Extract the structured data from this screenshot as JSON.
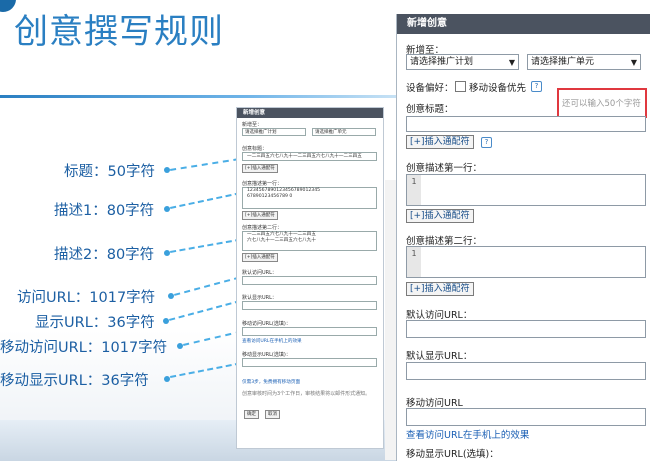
{
  "slide": {
    "title": "创意撰写规则"
  },
  "annotations": [
    {
      "label": "标题：50字符"
    },
    {
      "label": "描述1：80字符"
    },
    {
      "label": "描述2：80字符"
    },
    {
      "label": "访问URL：1017字符"
    },
    {
      "label": "显示URL：36字符"
    },
    {
      "label": "移动访问URL：1017字符"
    },
    {
      "label": "移动显示URL：36字符"
    }
  ],
  "mini_form": {
    "header": "新增创意",
    "add_to": "新增至：",
    "plan_select": "请选择推广计划",
    "unit_select": "请选择推广单元",
    "title_label": "创意标题：",
    "title_value": "一二三四五六七八九十一二三四五六七八九十一二三四五",
    "insert_wildcard": "插入通配符",
    "desc1_label": "创意描述第一行：",
    "desc1_line1": "1234567890123456789012345",
    "desc1_line2": "67890123456789 0",
    "desc2_label": "创意描述第二行：",
    "desc2_line1": "一二三四五六七八九十一二三四五",
    "desc2_line2": "六七八九十一二三四五六七八九十",
    "default_visit_label": "默认访问URL：",
    "default_display_label": "默认显示URL：",
    "mobile_visit_label": "移动访问URL(选填)：",
    "mobile_preview_link": "查看访问URL在手机上的效果",
    "mobile_display_label": "移动显示URL(选填)：",
    "phone_link": "仅需3步，免费拥有移动页面",
    "note": "创意审核时间为3个工作日，审核结果将以邮件形式通知。",
    "ok_button": "确定",
    "cancel_button": "取消"
  },
  "form": {
    "header": "新增创意",
    "add_to": "新增至：",
    "plan_select": "请选择推广计划",
    "unit_select": "请选择推广单元",
    "device_pref": "设备偏好：",
    "mobile_first": "移动设备优先",
    "help": "?",
    "title_label": "创意标题：",
    "title_hint": "还可以输入50个字符",
    "insert_wildcard": "插入通配符",
    "desc1_label": "创意描述第一行：",
    "desc2_label": "创意描述第二行：",
    "line_number": "1",
    "default_visit_label": "默认访问URL：",
    "default_display_label": "默认显示URL：",
    "mobile_visit_label": "移动访问URL",
    "mobile_preview_link": "查看访问URL在手机上的效果",
    "mobile_display_label": "移动显示URL(选填)："
  },
  "colors": {
    "title_blue": "#2a7fc2",
    "label_blue": "#1c5fa3",
    "dash_blue": "#4aaee6",
    "header_dark": "#4b5360",
    "highlight_red": "#e0383f"
  }
}
